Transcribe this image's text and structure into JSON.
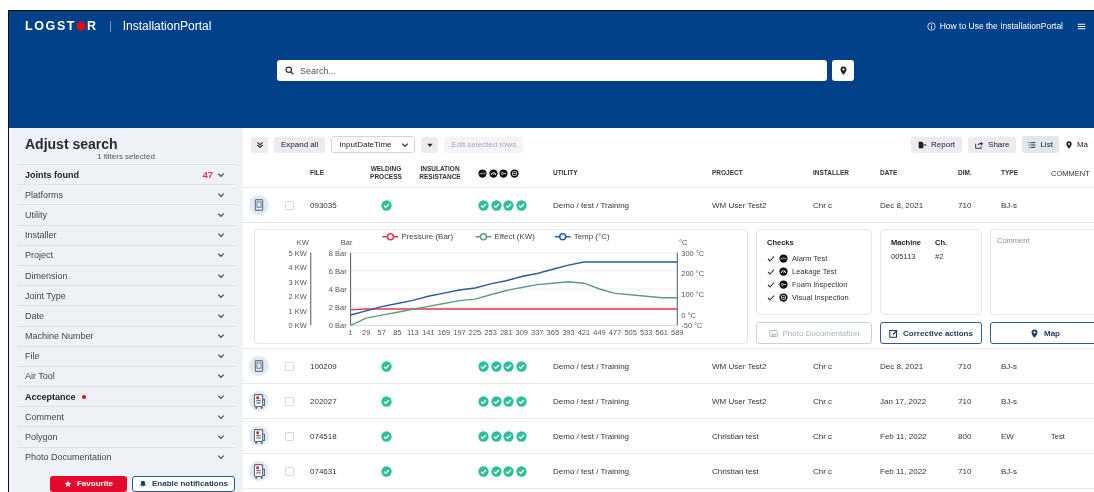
{
  "header": {
    "logo": {
      "before": "LOGST",
      "after": "R"
    },
    "app_name": "InstallationPortal",
    "help_link": "How to Use the InstallationPortal"
  },
  "search": {
    "placeholder": "Search..."
  },
  "sidebar": {
    "title": "Adjust search",
    "subtitle": "1 filters selected",
    "filters": [
      {
        "label": "Joints found",
        "bold": true,
        "count": "47",
        "flagged": false
      },
      {
        "label": "Platforms",
        "bold": false,
        "flagged": false
      },
      {
        "label": "Utility",
        "bold": false,
        "flagged": false
      },
      {
        "label": "Installer",
        "bold": false,
        "flagged": false
      },
      {
        "label": "Project",
        "bold": false,
        "flagged": false
      },
      {
        "label": "Dimension",
        "bold": false,
        "flagged": false
      },
      {
        "label": "Joint Type",
        "bold": false,
        "flagged": false
      },
      {
        "label": "Date",
        "bold": false,
        "flagged": false
      },
      {
        "label": "Machine Number",
        "bold": false,
        "flagged": false
      },
      {
        "label": "File",
        "bold": false,
        "flagged": false
      },
      {
        "label": "Air Tool",
        "bold": false,
        "flagged": false
      },
      {
        "label": "Acceptance",
        "bold": true,
        "flagged": true
      },
      {
        "label": "Comment",
        "bold": false,
        "flagged": false
      },
      {
        "label": "Polygon",
        "bold": false,
        "flagged": false
      },
      {
        "label": "Photo Documentation",
        "bold": false,
        "flagged": false
      }
    ],
    "buttons": [
      {
        "label": "Favourite",
        "kind": "primary"
      },
      {
        "label": "Enable notifications",
        "kind": "outline"
      }
    ]
  },
  "toolbar": {
    "expand_all": "Expand all",
    "sort_select": "InputDateTime",
    "edit_rows": {
      "label": "Edit selected rows",
      "disabled": true
    },
    "actions": [
      {
        "label": "Report",
        "kind": "report"
      },
      {
        "label": "Share",
        "kind": "share"
      }
    ],
    "views": [
      {
        "label": "List",
        "kind": "list",
        "selected": true
      },
      {
        "label": "Ma",
        "kind": "map",
        "selected": false
      }
    ]
  },
  "table": {
    "columns": [
      {
        "kind": "file",
        "label": "FILE"
      },
      {
        "kind": "welding",
        "label": "WELDING PROCESS"
      },
      {
        "kind": "insulation",
        "label": "INSULATION RESISTANCE"
      },
      {
        "kind": "checks"
      },
      {
        "kind": "utility",
        "label": "UTILITY"
      },
      {
        "kind": "project",
        "label": "PROJECT"
      },
      {
        "kind": "installer",
        "label": "INSTALLER"
      },
      {
        "kind": "date",
        "label": "DATE"
      },
      {
        "kind": "dim",
        "label": "DIM."
      },
      {
        "kind": "type",
        "label": "TYPE"
      },
      {
        "kind": "comment",
        "label": "COMMENT"
      }
    ],
    "rows": [
      {
        "kind": "handheld",
        "selected": false,
        "expanded": true,
        "file": "093035",
        "welding_ok": true,
        "checks": [
          true,
          true,
          true,
          true
        ],
        "utility": "Demo / test / Training",
        "project": "WM User Test2",
        "installer": "Chr c",
        "date": "Dec 8, 2021",
        "dim": "710",
        "type": "BJ-s",
        "details": {
          "chart_data": {
            "type": "line",
            "grid": true,
            "legend": "top",
            "x": [
              1,
              29,
              57,
              85,
              113,
              141,
              169,
              197,
              225,
              253,
              281,
              309,
              337,
              365,
              393,
              421,
              449,
              477,
              505,
              533,
              561,
              589
            ],
            "xlim": [
              1,
              589
            ],
            "xticks": [
              1,
              29,
              57,
              85,
              113,
              141,
              169,
              197,
              225,
              253,
              281,
              309,
              337,
              365,
              393,
              421,
              449,
              477,
              505,
              533,
              561,
              589
            ],
            "ylabel": "Bar",
            "ylim": [
              0,
              8
            ],
            "yticks": [
              {
                "value": 0,
                "label": "0 Bar"
              },
              {
                "value": 2,
                "label": "2 Bar"
              },
              {
                "value": 4,
                "label": "4 Bar"
              },
              {
                "value": 6,
                "label": "6 Bar"
              },
              {
                "value": 8,
                "label": "8 Bar"
              }
            ],
            "y2label": "KW",
            "y2lim": [
              0,
              5
            ],
            "y2ticks": [
              {
                "value": 0,
                "label": "0 KW"
              },
              {
                "value": 1,
                "label": "1 KW"
              },
              {
                "value": 2,
                "label": "2 KW"
              },
              {
                "value": 3,
                "label": "3 KW"
              },
              {
                "value": 4,
                "label": "4 KW"
              },
              {
                "value": 5,
                "label": "5 KW"
              }
            ],
            "y3label": "°C",
            "y3lim": [
              -50,
              300
            ],
            "y3ticks": [
              {
                "value": -50,
                "label": "-50 °C"
              },
              {
                "value": 0,
                "label": "0 °C"
              },
              {
                "value": 100,
                "label": "100 °C"
              },
              {
                "value": 200,
                "label": "200 °C"
              },
              {
                "value": 300,
                "label": "300 °C"
              }
            ],
            "series": [
              {
                "name": "Pressure (Bar)",
                "color": "#e8334a",
                "values": [
                  1.7,
                  1.8,
                  1.8,
                  1.8,
                  1.8,
                  1.8,
                  1.8,
                  1.8,
                  1.8,
                  1.8,
                  1.8,
                  1.8,
                  1.8,
                  1.8,
                  1.8,
                  1.8,
                  1.8,
                  1.8,
                  1.8,
                  1.8,
                  1.8,
                  1.8
                ]
              },
              {
                "name": "Effect (KW)",
                "color": "#5e9e7a",
                "axis": "y2",
                "values": [
                  0,
                  0.5,
                  0.7,
                  0.9,
                  1.1,
                  1.3,
                  1.5,
                  1.7,
                  1.8,
                  2.1,
                  2.4,
                  2.6,
                  2.8,
                  2.9,
                  3,
                  2.9,
                  2.5,
                  2.2,
                  2.1,
                  2,
                  1.9,
                  1.9
                ]
              },
              {
                "name": "Temp (°C)",
                "color": "#2a5aa0",
                "axis": "y3",
                "values": [
                  0,
                  20,
                  40,
                  55,
                  70,
                  90,
                  105,
                  120,
                  130,
                  150,
                  165,
                  185,
                  200,
                  220,
                  240,
                  255,
                  255,
                  255,
                  255,
                  255,
                  255,
                  255
                ]
              }
            ]
          },
          "checks": {
            "title": "Checks",
            "items": [
              {
                "label": "Alarm Test",
                "checked": true
              },
              {
                "label": "Leakage Test",
                "checked": true
              },
              {
                "label": "Foam Inspection",
                "checked": true
              },
              {
                "label": "Visual Inspection",
                "checked": true
              }
            ]
          },
          "machine": {
            "label": "Machine",
            "value": "005113"
          },
          "channel": {
            "label": "Ch.",
            "value": "#2"
          },
          "comment": {
            "placeholder": "Comment"
          },
          "buttons": [
            {
              "label": "Photo Documentation",
              "kind": "photo",
              "disabled": true
            },
            {
              "label": "Corrective actions",
              "kind": "edit",
              "disabled": false
            },
            {
              "label": "Map",
              "kind": "map",
              "disabled": false
            }
          ]
        }
      },
      {
        "kind": "handheld",
        "selected": false,
        "expanded": false,
        "file": "100209",
        "welding_ok": true,
        "checks": [
          true,
          true,
          true,
          true
        ],
        "utility": "Demo / test / Training",
        "project": "WM User Test2",
        "installer": "Chr c",
        "date": "Dec 8, 2021",
        "dim": "710",
        "type": "BJ-s"
      },
      {
        "kind": "machine",
        "selected": false,
        "expanded": false,
        "file": "202027",
        "welding_ok": true,
        "checks": [
          true,
          true,
          true,
          true
        ],
        "utility": "Demo / test / Training",
        "project": "WM User Test2",
        "installer": "Chr c",
        "date": "Jan 17, 2022",
        "dim": "710",
        "type": "BJ-s"
      },
      {
        "kind": "machine",
        "selected": false,
        "expanded": false,
        "file": "074518",
        "welding_ok": true,
        "checks": [
          true,
          true,
          true,
          true
        ],
        "utility": "Demo / test / Training",
        "project": "Christian test",
        "installer": "Chr c",
        "date": "Feb 11, 2022",
        "dim": "800",
        "type": "EW",
        "comment": "Test"
      },
      {
        "kind": "machine",
        "selected": false,
        "expanded": false,
        "file": "074631",
        "welding_ok": true,
        "checks": [
          true,
          true,
          true,
          true
        ],
        "utility": "Demo / test / Training",
        "project": "Christian test",
        "installer": "Chr c",
        "date": "Feb 11, 2022",
        "dim": "710",
        "type": "BJ-s"
      }
    ]
  }
}
